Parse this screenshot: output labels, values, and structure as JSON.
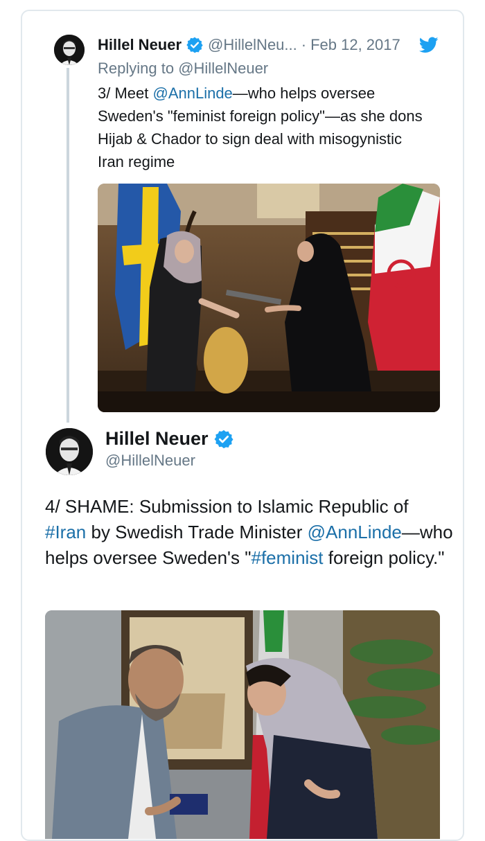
{
  "colors": {
    "link": "#1b6fa8",
    "muted": "#657786",
    "verified": "#1da1f2",
    "twitter": "#1da1f2",
    "border": "#e1e8ed"
  },
  "tweet1": {
    "name": "Hillel Neuer",
    "handle": "@HillelNeu...",
    "separator": "·",
    "date": "Feb 12, 2017",
    "replying_prefix": "Replying to",
    "replying_handle": "@HillelNeuer",
    "text_1": "3/ Meet ",
    "mention": "@AnnLinde",
    "text_2": "—who helps oversee Sweden's \"feminist foreign policy\"—as she dons Hijab & Chador to sign deal with misogynistic Iran regime",
    "icon": "twitter-bird-icon",
    "verified_icon": "verified-badge-icon"
  },
  "tweet2": {
    "name": "Hillel Neuer",
    "handle": "@HillelNeuer",
    "text_1": "4/ SHAME: Submission to Islamic Republic of ",
    "hashtag_iran": "#Iran",
    "text_2": " by Swedish Trade Minister ",
    "mention": "@AnnLinde",
    "text_3": "—who helps oversee Sweden's \"",
    "hashtag_feminist": "#feminist",
    "text_4": " foreign policy.\"",
    "verified_icon": "verified-badge-icon"
  }
}
